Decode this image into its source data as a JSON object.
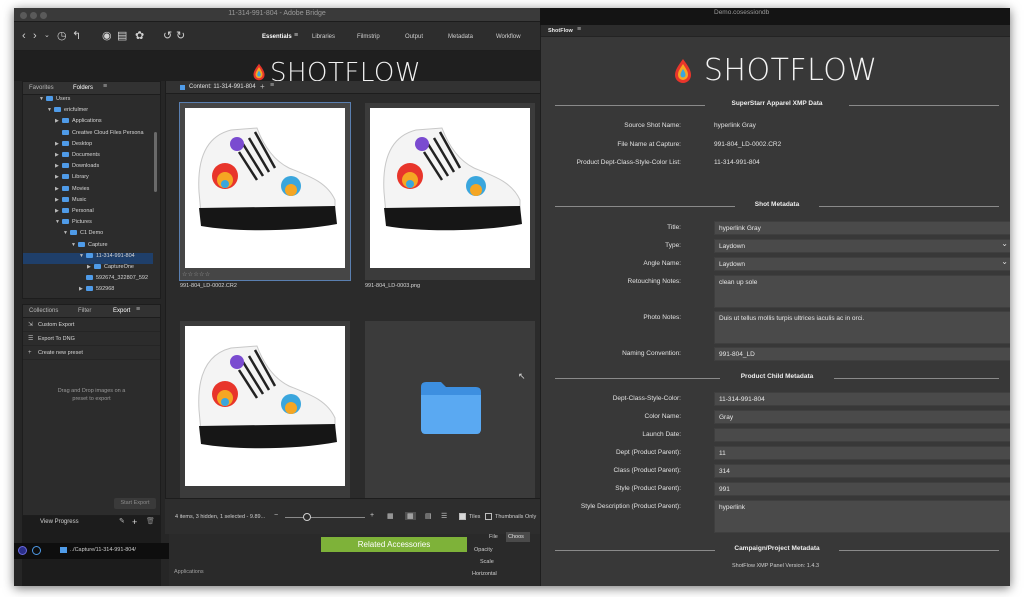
{
  "bridge": {
    "window_title": "11-314-991-804 - Adobe Bridge",
    "workspaces": [
      "Essentials",
      "Libraries",
      "Filmstrip",
      "Output",
      "Metadata",
      "Workflow"
    ],
    "top_tabs": {
      "favorites": "Favorites",
      "folders": "Folders"
    },
    "folder_tree": [
      {
        "label": "Users",
        "depth": 2,
        "arrow": "down"
      },
      {
        "label": "ericfulmer",
        "depth": 3,
        "arrow": "down"
      },
      {
        "label": "Applications",
        "depth": 4,
        "arrow": "right"
      },
      {
        "label": "Creative Cloud Files Persona",
        "depth": 4,
        "arrow": "none"
      },
      {
        "label": "Desktop",
        "depth": 4,
        "arrow": "right"
      },
      {
        "label": "Documents",
        "depth": 4,
        "arrow": "right"
      },
      {
        "label": "Downloads",
        "depth": 4,
        "arrow": "right"
      },
      {
        "label": "Library",
        "depth": 4,
        "arrow": "right"
      },
      {
        "label": "Movies",
        "depth": 4,
        "arrow": "right"
      },
      {
        "label": "Music",
        "depth": 4,
        "arrow": "right"
      },
      {
        "label": "Personal",
        "depth": 4,
        "arrow": "right"
      },
      {
        "label": "Pictures",
        "depth": 4,
        "arrow": "down"
      },
      {
        "label": "C1 Demo",
        "depth": 5,
        "arrow": "down"
      },
      {
        "label": "Capture",
        "depth": 6,
        "arrow": "down"
      },
      {
        "label": "11-314-991-804",
        "depth": 7,
        "arrow": "down",
        "selected": true
      },
      {
        "label": "CaptureOne",
        "depth": 8,
        "arrow": "right"
      },
      {
        "label": "592674_322807_592",
        "depth": 7,
        "arrow": "none"
      },
      {
        "label": "592968",
        "depth": 7,
        "arrow": "right"
      }
    ],
    "bottom_tabs": {
      "collections": "Collections",
      "filter": "Filter",
      "export": "Export"
    },
    "export_items": [
      {
        "label": "Custom Export",
        "icon": "export-icon"
      },
      {
        "label": "Export To DNG",
        "icon": "dng-icon"
      },
      {
        "label": "Create new preset",
        "icon": "plus-icon"
      }
    ],
    "drop_message_line1": "Drag and Drop images on a",
    "drop_message_line2": "preset to export",
    "start_export": "Start Export",
    "view_progress": "View Progress",
    "edit": "Edit",
    "content_header": "Content: 11-314-991-804",
    "thumbnails": [
      {
        "name": "991-804_LD-0002.CR2",
        "rating": "☆☆☆☆☆",
        "selected": true
      },
      {
        "name": "991-804_LD-0003.png",
        "rating": "",
        "selected": false
      },
      {
        "name": "",
        "rating": "",
        "selected": false
      },
      {
        "name": "",
        "rating": "",
        "selected": false
      }
    ],
    "status_text": "4 items, 3 hidden, 1 selected - 9.89...",
    "tiles_label": "Tiles",
    "thumbnails_only_label": "Thumbnails Only",
    "capture_path": "../Capture/11-314-991-804/"
  },
  "background_app": {
    "button": "Related Accessories",
    "file_label": "File",
    "choose": "Choos",
    "opacity": "Opacity",
    "scale": "Scale",
    "horizontal": "Horizontal",
    "applications": "Applications",
    "terminal_title": "Demo.cosessiondb"
  },
  "shotflow": {
    "panel_tab": "ShotFlow",
    "logo_text": "SHOTFLOW",
    "sections": {
      "xmp": "SuperStarr Apparel XMP Data",
      "shot": "Shot Metadata",
      "child": "Product Child Metadata",
      "campaign": "Campaign/Project Metadata"
    },
    "xmp_rows": [
      {
        "label": "Source Shot Name:",
        "value": "hyperlink Gray"
      },
      {
        "label": "File Name at Capture:",
        "value": "991-804_LD-0002.CR2"
      },
      {
        "label": "Product Dept-Class-Style-Color List:",
        "value": "11-314-991-804"
      }
    ],
    "shot_rows": [
      {
        "label": "Title:",
        "value": "hyperlink Gray",
        "kind": "text"
      },
      {
        "label": "Type:",
        "value": "Laydown",
        "kind": "select"
      },
      {
        "label": "Angle Name:",
        "value": "Laydown",
        "kind": "select"
      },
      {
        "label": "Retouching Notes:",
        "value": "clean up sole",
        "kind": "area"
      },
      {
        "label": "Photo Notes:",
        "value": "Duis ut tellus mollis turpis ultrices iaculis ac in orci.",
        "kind": "area"
      },
      {
        "label": "Naming Convention:",
        "value": "991-804_LD",
        "kind": "text"
      }
    ],
    "child_rows": [
      {
        "label": "Dept-Class-Style-Color:",
        "value": "11-314-991-804",
        "kind": "text"
      },
      {
        "label": "Color Name:",
        "value": "Gray",
        "kind": "text"
      },
      {
        "label": "Launch Date:",
        "value": "",
        "kind": "text"
      },
      {
        "label": "Dept (Product Parent):",
        "value": "11",
        "kind": "text"
      },
      {
        "label": "Class (Product Parent):",
        "value": "314",
        "kind": "text"
      },
      {
        "label": "Style (Product Parent):",
        "value": "991",
        "kind": "text"
      },
      {
        "label": "Style Description (Product Parent):",
        "value": "hyperlink",
        "kind": "area"
      }
    ],
    "version": "ShotFlow XMP Panel Version: 1.4.3"
  },
  "colors": {
    "accent_blue": "#4f9be8",
    "green_button": "#7eb239",
    "panel_bg": "#383838",
    "logo_drop": [
      "#e8352b",
      "#f5a623",
      "#3aa6dd",
      "#7a4bd0"
    ]
  }
}
